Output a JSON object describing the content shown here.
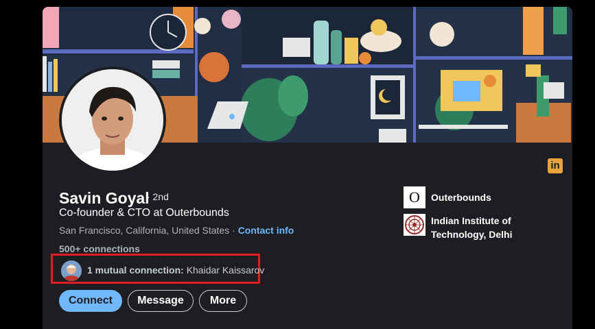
{
  "profile": {
    "name": "Savin Goyal",
    "degree": "· 2nd",
    "headline": "Co-founder & CTO at Outerbounds",
    "location": "San Francisco, California, United States",
    "separator": "·",
    "contact_info": "Contact info",
    "connections": "500+ connections"
  },
  "mutual": {
    "label": "1 mutual connection:",
    "name": "Khaidar Kaissarov"
  },
  "actions": {
    "connect": "Connect",
    "message": "Message",
    "more": "More"
  },
  "organizations": [
    {
      "name": "Outerbounds",
      "logo_letter": "O"
    },
    {
      "name": "Indian Institute of Technology, Delhi"
    }
  ],
  "colors": {
    "background": "#000000",
    "card": "#1c1e21",
    "accent": "#71b7fb",
    "linkedin_badge": "#e7a33e",
    "highlight_box": "#e01b24"
  }
}
